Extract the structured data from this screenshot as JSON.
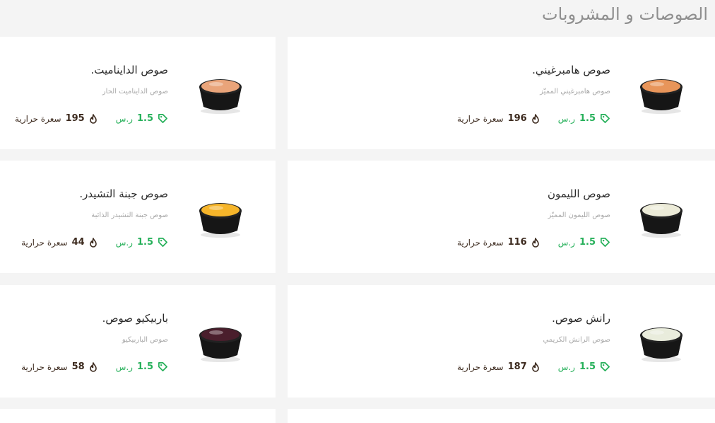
{
  "page": {
    "title": "الصوصات و المشروبات"
  },
  "colors": {
    "price": "#26b05a",
    "calorie": "#3c2a1e",
    "title": "#8f8f8f"
  },
  "items": [
    {
      "name": "صوص هامبرغيني.",
      "desc": "صوص هامبرغيني المميّز",
      "price": "1.5",
      "currency": "ر.س",
      "calories": "196",
      "cal_label": "سعرة حرارية",
      "sauce_color": "#e8955a"
    },
    {
      "name": "صوص الدايناميت.",
      "desc": "صوص الدايناميت الحار",
      "price": "1.5",
      "currency": "ر.س",
      "calories": "195",
      "cal_label": "سعرة حرارية",
      "sauce_color": "#e9a47a"
    },
    {
      "name": "صوص الليمون",
      "desc": "صوص الليمون المميّز",
      "price": "1.5",
      "currency": "ر.س",
      "calories": "116",
      "cal_label": "سعرة حرارية",
      "sauce_color": "#ecebd8"
    },
    {
      "name": "صوص جبنة التشيدر.",
      "desc": "صوص جبنة التشيدر الذائبة",
      "price": "1.5",
      "currency": "ر.س",
      "calories": "44",
      "cal_label": "سعرة حرارية",
      "sauce_color": "#f6b52a"
    },
    {
      "name": "رانش صوص.",
      "desc": "صوص الرانش الكريمي",
      "price": "1.5",
      "currency": "ر.س",
      "calories": "187",
      "cal_label": "سعرة حرارية",
      "sauce_color": "#e9ecdc"
    },
    {
      "name": "باربيكيو صوص.",
      "desc": "صوص الباربيكيو",
      "price": "1.5",
      "currency": "ر.س",
      "calories": "58",
      "cal_label": "سعرة حرارية",
      "sauce_color": "#4a1e2c"
    }
  ]
}
